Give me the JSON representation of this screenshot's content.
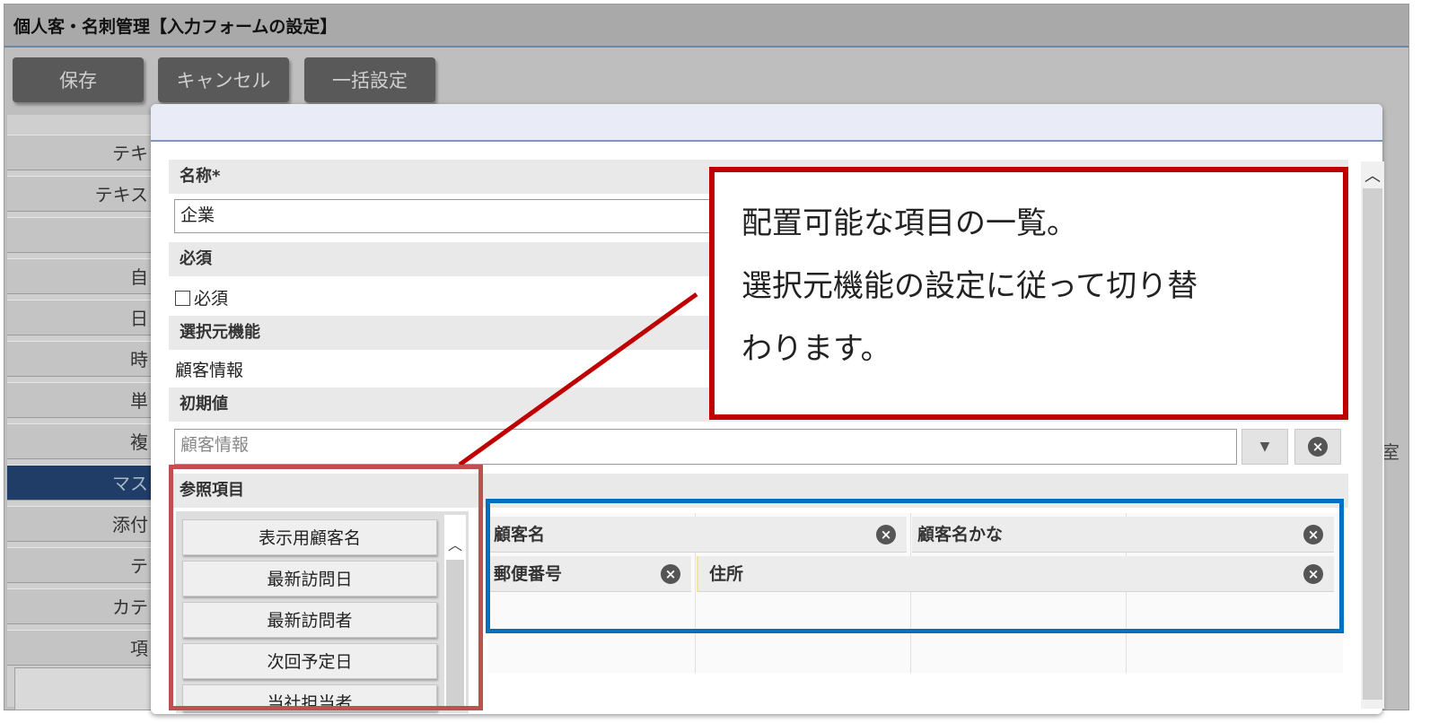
{
  "window": {
    "title": "個人客・名刺管理【入力フォームの設定】"
  },
  "toolbar": {
    "save": "保存",
    "cancel": "キャンセル",
    "bulk": "一括設定"
  },
  "left_menu": [
    {
      "label": "テキ"
    },
    {
      "label": "テキス"
    },
    {
      "label": ""
    },
    {
      "label": "自"
    },
    {
      "label": "日"
    },
    {
      "label": "時"
    },
    {
      "label": "単"
    },
    {
      "label": "複"
    },
    {
      "label": "マス",
      "active": true
    },
    {
      "label": "添付"
    },
    {
      "label": "テ"
    },
    {
      "label": "カテ"
    },
    {
      "label": "項"
    }
  ],
  "right_edge_text": "室",
  "form": {
    "name_label": "名称*",
    "name_value": "企業",
    "required_label": "必須",
    "required_checkbox_label": "必須",
    "source_label": "選択元機能",
    "source_value": "顧客情報",
    "initial_label": "初期値",
    "initial_placeholder": "顧客情報",
    "ref_label": "参照項目"
  },
  "ref_items": [
    "表示用顧客名",
    "最新訪問日",
    "最新訪問者",
    "次回予定日",
    "当社担当者"
  ],
  "layout_cells": {
    "row1": [
      "顧客名",
      "顧客名かな"
    ],
    "row2": [
      "郵便番号",
      "住所"
    ]
  },
  "callout": {
    "line1": "配置可能な項目の一覧。",
    "line2": "選択元機能の設定に従って切り替",
    "line3": "わります。"
  },
  "icons": {
    "dropdown": "chevron-down-icon",
    "clear": "clear-icon",
    "scroll_up": "chevron-up-icon"
  },
  "colors": {
    "callout_border": "#c00000",
    "red_highlight": "#c0504d",
    "blue_highlight": "#0070c0",
    "active_menu": "#1f3d67"
  }
}
